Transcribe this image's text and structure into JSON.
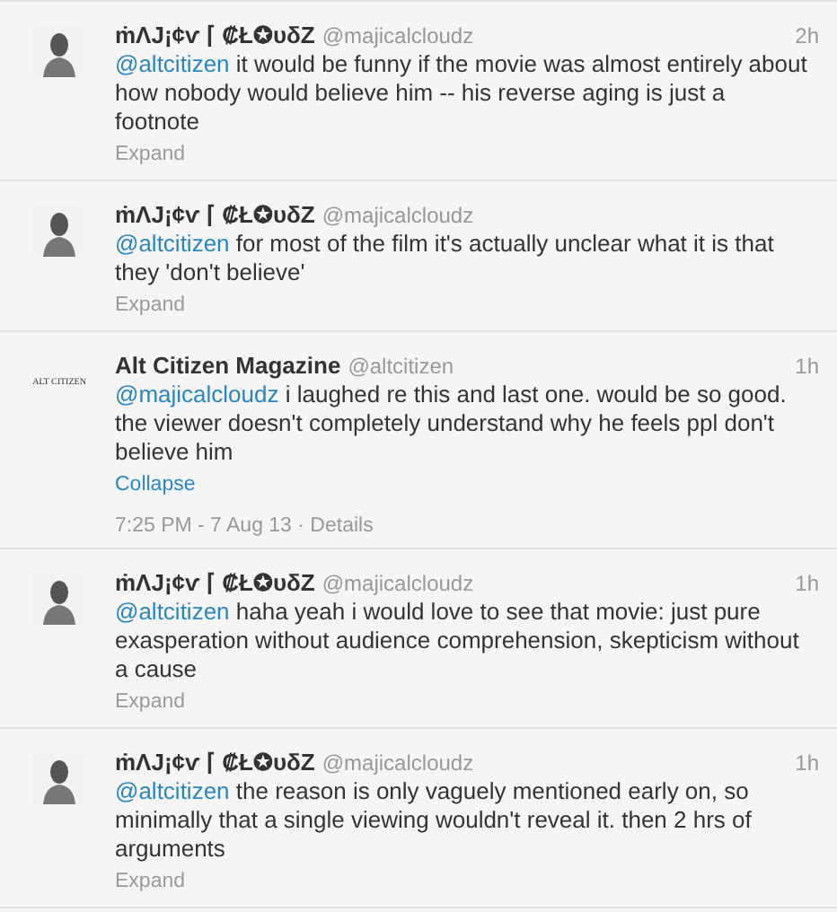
{
  "tweets": [
    {
      "kind": "person",
      "name": "ṁɅJ¡¢ѵ ⌈ ₡Ł✪υδZ",
      "handle": "@majicalcloudz",
      "time": "2h",
      "mention": "@altcitizen",
      "text": " it would be funny if the movie was almost entirely about how nobody would believe him -- his reverse aging is just a footnote",
      "toggle": "Expand",
      "expanded": false
    },
    {
      "kind": "person",
      "name": "ṁɅJ¡¢ѵ ⌈ ₡Ł✪υδZ",
      "handle": "@majicalcloudz",
      "mention": "@altcitizen",
      "text": " for most of the film it's actually unclear what it is that they 'don't believe'",
      "toggle": "Expand",
      "expanded": false
    },
    {
      "kind": "logo",
      "logo_text": "ALT CITIZEN",
      "name": "Alt Citizen Magazine",
      "handle": "@altcitizen",
      "time": "1h",
      "mention": "@majicalcloudz",
      "text": " i laughed re this and last one. would be so good. the viewer doesn't completely understand why he feels ppl don't believe him",
      "toggle": "Collapse",
      "expanded": true,
      "details": "7:25 PM - 7 Aug 13 · Details"
    },
    {
      "kind": "person",
      "name": "ṁɅJ¡¢ѵ ⌈ ₡Ł✪υδZ",
      "handle": "@majicalcloudz",
      "time": "1h",
      "mention": "@altcitizen",
      "text": " haha yeah i would love to see that movie: just pure exasperation without audience comprehension, skepticism without a cause",
      "toggle": "Expand",
      "expanded": false
    },
    {
      "kind": "person",
      "name": "ṁɅJ¡¢ѵ ⌈ ₡Ł✪υδZ",
      "handle": "@majicalcloudz",
      "time": "1h",
      "mention": "@altcitizen",
      "text": " the reason is only vaguely mentioned early on, so minimally that a single viewing wouldn't reveal it. then 2 hrs of arguments",
      "toggle": "Expand",
      "expanded": false
    }
  ]
}
